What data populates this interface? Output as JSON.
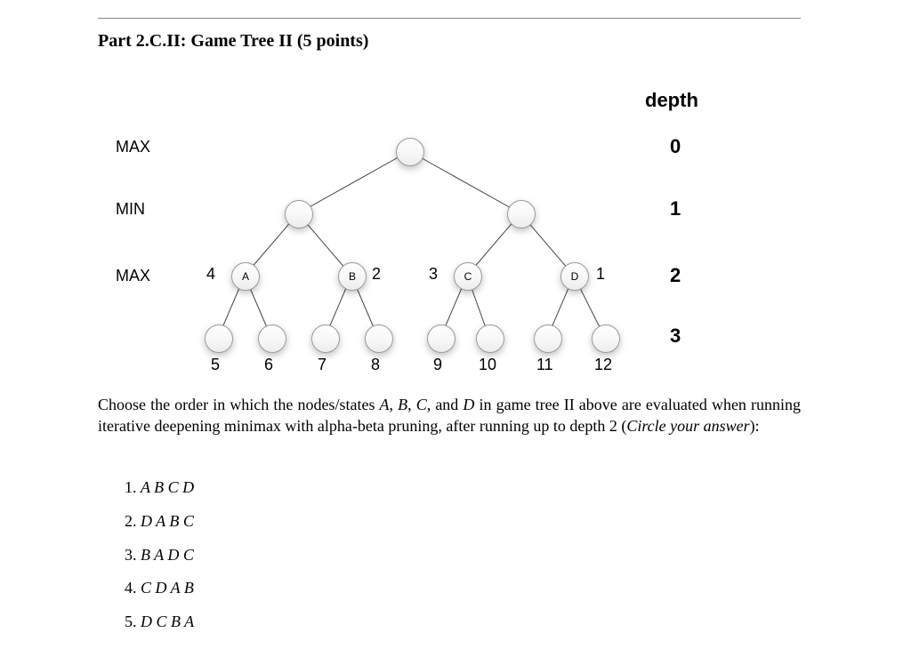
{
  "title": "Part 2.C.II: Game Tree II (5 points)",
  "depth_header": "depth",
  "rows": {
    "max0": "MAX",
    "min1": "MIN",
    "max2": "MAX"
  },
  "depths": {
    "d0": "0",
    "d1": "1",
    "d2": "2",
    "d3": "3"
  },
  "side_labels": {
    "A_left": "4",
    "B_right": "2",
    "C_left": "3",
    "D_right": "1"
  },
  "node_labels": {
    "A": "A",
    "B": "B",
    "C": "C",
    "D": "D"
  },
  "leaf_labels": {
    "l5": "5",
    "l6": "6",
    "l7": "7",
    "l8": "8",
    "l9": "9",
    "l10": "10",
    "l11": "11",
    "l12": "12"
  },
  "question_parts": {
    "p1": "Choose the order in which the nodes/states ",
    "A": "A",
    "comma1": ", ",
    "B": "B",
    "comma2": ", ",
    "C": "C",
    "comma3": ", and ",
    "D": "D",
    "p2": " in game tree II above are evaluated when running iterative deepening minimax with alpha-beta pruning, after running up to depth 2 (",
    "italic": "Circle your answer",
    "p3": "):"
  },
  "choices": {
    "c1n": "1. ",
    "c1": "A B C D",
    "c2n": "2. ",
    "c2": "D A B C",
    "c3n": "3. ",
    "c3": "B A D C",
    "c4n": "4. ",
    "c4": "C D A B",
    "c5n": "5. ",
    "c5": "D C B A"
  }
}
